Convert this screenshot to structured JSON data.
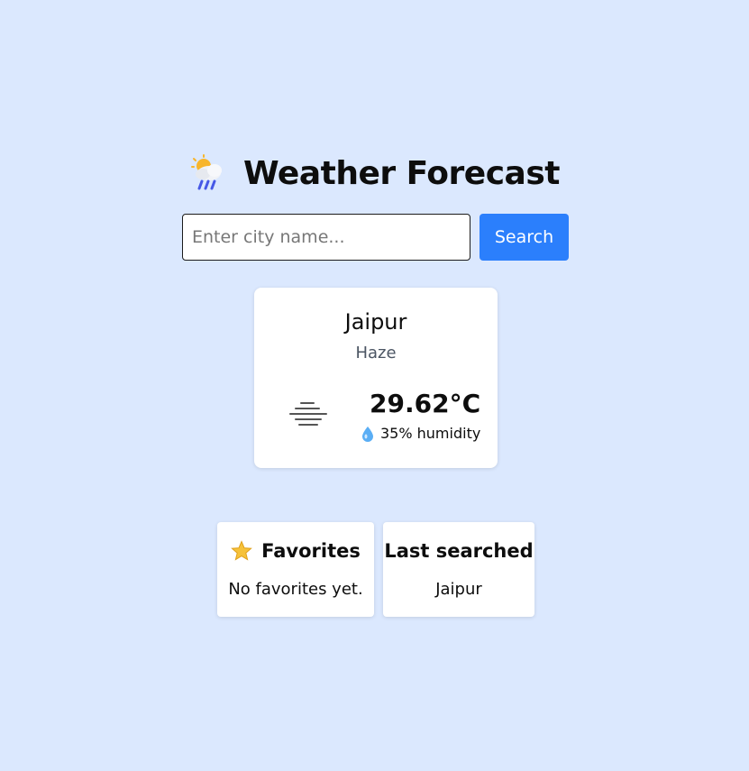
{
  "header": {
    "title": "Weather Forecast",
    "icon": "sun-cloud-rain-icon"
  },
  "search": {
    "placeholder": "Enter city name...",
    "value": "",
    "button_label": "Search"
  },
  "weather": {
    "city": "Jaipur",
    "condition": "Haze",
    "condition_icon": "haze-icon",
    "temperature": "29.62°C",
    "humidity": "35% humidity",
    "humidity_icon": "droplet-icon"
  },
  "favorites": {
    "title": "Favorites",
    "icon": "star-icon",
    "empty_text": "No favorites yet."
  },
  "last_searched": {
    "title": "Last searched",
    "value": "Jaipur"
  },
  "colors": {
    "background": "#dbe8fe",
    "accent": "#2b7ffc",
    "card": "#ffffff"
  }
}
